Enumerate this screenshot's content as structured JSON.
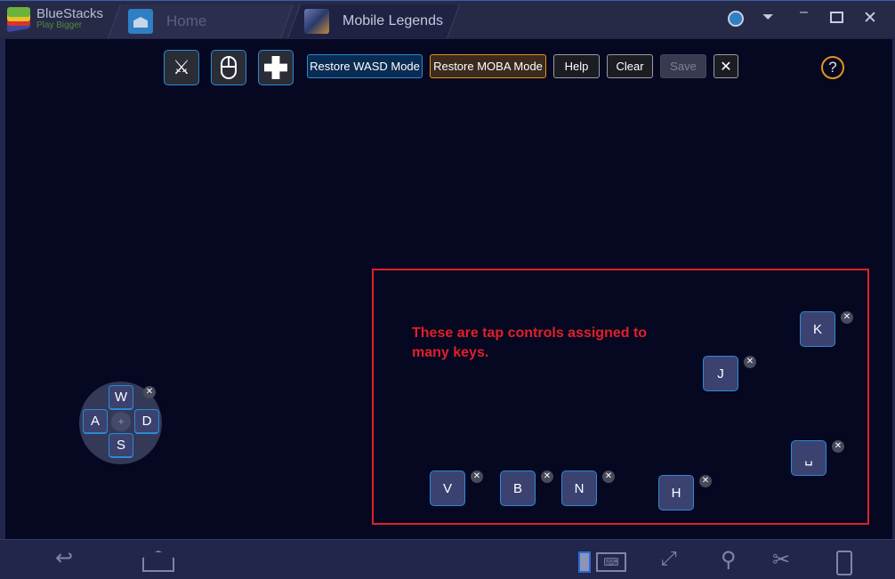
{
  "titlebar": {
    "brand": "BlueStacks",
    "tagline": "Play Bigger",
    "tabs": [
      {
        "label": "Home"
      },
      {
        "label": "Mobile Legends"
      }
    ]
  },
  "toolbar": {
    "restore_wasd": "Restore WASD Mode",
    "restore_moba": "Restore MOBA Mode",
    "help": "Help",
    "clear": "Clear",
    "save": "Save",
    "close": "✕",
    "help_icon": "?"
  },
  "annotation": "These are tap controls assigned to many keys.",
  "dpad": {
    "up": "W",
    "left": "A",
    "right": "D",
    "down": "S"
  },
  "keys": {
    "v": "V",
    "b": "B",
    "n": "N",
    "h": "H",
    "j": "J",
    "k": "K",
    "space": "␣"
  },
  "colors": {
    "accent": "#2b8ad6",
    "moba": "#e39417",
    "annotation": "#e0202a"
  }
}
